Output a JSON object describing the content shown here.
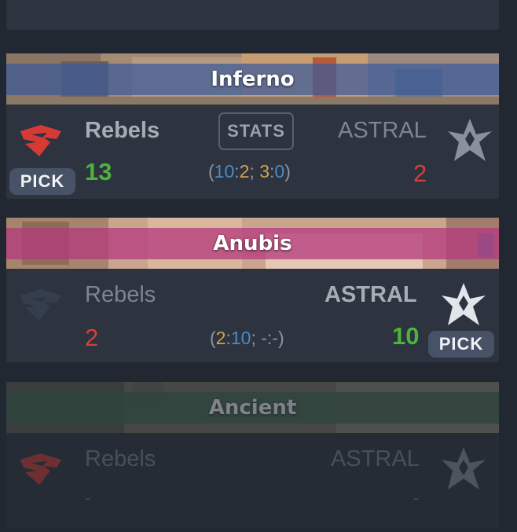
{
  "maps": [
    {
      "name": "Inferno",
      "stats_label": "STATS",
      "team1": {
        "name": "Rebels",
        "score": "13",
        "pick_label": "PICK"
      },
      "team2": {
        "name": "ASTRAL",
        "score": "2"
      },
      "halves": {
        "open": "(",
        "a": "10",
        "sep1": ":",
        "b": "2",
        "semi": "; ",
        "c": "3",
        "sep2": ":",
        "d": "0",
        "close": ")"
      },
      "colors": {
        "banner_band": "#3c5a9a"
      }
    },
    {
      "name": "Anubis",
      "team1": {
        "name": "Rebels",
        "score": "2"
      },
      "team2": {
        "name": "ASTRAL",
        "score": "10",
        "pick_label": "PICK"
      },
      "halves": {
        "open": "(",
        "a": "2",
        "sep1": ":",
        "b": "10",
        "semi": "; ",
        "rest": "-:-)"
      },
      "colors": {
        "banner_band": "#b53a7e"
      }
    },
    {
      "name": "Ancient",
      "team1": {
        "name": "Rebels",
        "score": "-"
      },
      "team2": {
        "name": "ASTRAL",
        "score": "-"
      },
      "colors": {
        "banner_band": "#3f6b4c"
      }
    }
  ],
  "icons": {
    "team1_logo": "rebels-logo-icon",
    "team2_logo": "astral-logo-icon"
  },
  "colors": {
    "win": "#4db23e",
    "lose": "#d4403b",
    "ct_side": "#4d8ac0",
    "t_side": "#d3a24a",
    "card_bg": "#2d333f"
  }
}
